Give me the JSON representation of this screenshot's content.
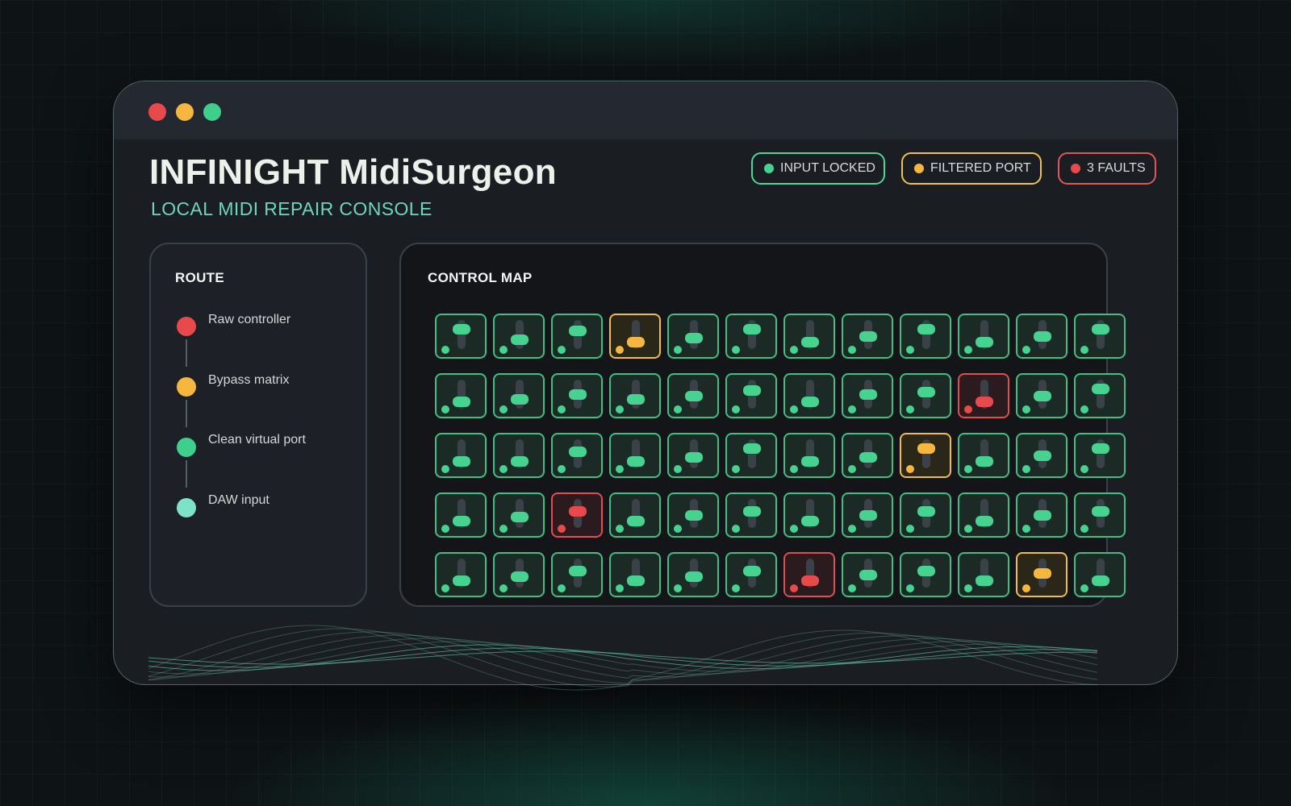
{
  "window": {
    "controls": [
      "close",
      "minimize",
      "maximize"
    ]
  },
  "header": {
    "title": "INFINIGHT MidiSurgeon",
    "subtitle": "LOCAL MIDI REPAIR CONSOLE"
  },
  "status": {
    "input": "INPUT LOCKED",
    "port": "FILTERED PORT",
    "faults": "3 FAULTS"
  },
  "route": {
    "title": "ROUTE",
    "steps": [
      {
        "label": "Raw controller",
        "color": "#e84a4c"
      },
      {
        "label": "Bypass matrix",
        "color": "#f6b73f"
      },
      {
        "label": "Clean virtual port",
        "color": "#3fcf8c"
      },
      {
        "label": "DAW input",
        "color": "#7ee2c6"
      }
    ]
  },
  "control_map": {
    "title": "CONTROL MAP",
    "columns": 12,
    "rows": [
      [
        {
          "s": "ok",
          "v": 0.8
        },
        {
          "s": "ok",
          "v": 0.2
        },
        {
          "s": "ok",
          "v": 0.7
        },
        {
          "s": "filtered",
          "v": 0.1
        },
        {
          "s": "ok",
          "v": 0.3
        },
        {
          "s": "ok",
          "v": 0.8
        },
        {
          "s": "ok",
          "v": 0.1
        },
        {
          "s": "ok",
          "v": 0.4
        },
        {
          "s": "ok",
          "v": 0.8
        },
        {
          "s": "ok",
          "v": 0.1
        },
        {
          "s": "ok",
          "v": 0.4
        },
        {
          "s": "ok",
          "v": 0.8
        }
      ],
      [
        {
          "s": "ok",
          "v": 0.1
        },
        {
          "s": "ok",
          "v": 0.2
        },
        {
          "s": "ok",
          "v": 0.5
        },
        {
          "s": "ok",
          "v": 0.2
        },
        {
          "s": "ok",
          "v": 0.4
        },
        {
          "s": "ok",
          "v": 0.7
        },
        {
          "s": "ok",
          "v": 0.1
        },
        {
          "s": "ok",
          "v": 0.5
        },
        {
          "s": "ok",
          "v": 0.6
        },
        {
          "s": "fault",
          "v": 0.1
        },
        {
          "s": "ok",
          "v": 0.4
        },
        {
          "s": "ok",
          "v": 0.8
        }
      ],
      [
        {
          "s": "ok",
          "v": 0.1
        },
        {
          "s": "ok",
          "v": 0.1
        },
        {
          "s": "ok",
          "v": 0.6
        },
        {
          "s": "ok",
          "v": 0.1
        },
        {
          "s": "ok",
          "v": 0.3
        },
        {
          "s": "ok",
          "v": 0.8
        },
        {
          "s": "ok",
          "v": 0.1
        },
        {
          "s": "ok",
          "v": 0.3
        },
        {
          "s": "filtered",
          "v": 0.8
        },
        {
          "s": "ok",
          "v": 0.1
        },
        {
          "s": "ok",
          "v": 0.4
        },
        {
          "s": "ok",
          "v": 0.8
        }
      ],
      [
        {
          "s": "ok",
          "v": 0.1
        },
        {
          "s": "ok",
          "v": 0.3
        },
        {
          "s": "fault",
          "v": 0.6
        },
        {
          "s": "ok",
          "v": 0.1
        },
        {
          "s": "ok",
          "v": 0.4
        },
        {
          "s": "ok",
          "v": 0.6
        },
        {
          "s": "ok",
          "v": 0.1
        },
        {
          "s": "ok",
          "v": 0.4
        },
        {
          "s": "ok",
          "v": 0.6
        },
        {
          "s": "ok",
          "v": 0.1
        },
        {
          "s": "ok",
          "v": 0.4
        },
        {
          "s": "ok",
          "v": 0.6
        }
      ],
      [
        {
          "s": "ok",
          "v": 0.1
        },
        {
          "s": "ok",
          "v": 0.3
        },
        {
          "s": "ok",
          "v": 0.6
        },
        {
          "s": "ok",
          "v": 0.1
        },
        {
          "s": "ok",
          "v": 0.3
        },
        {
          "s": "ok",
          "v": 0.6
        },
        {
          "s": "fault",
          "v": 0.1
        },
        {
          "s": "ok",
          "v": 0.4
        },
        {
          "s": "ok",
          "v": 0.6
        },
        {
          "s": "ok",
          "v": 0.1
        },
        {
          "s": "filtered",
          "v": 0.5
        },
        {
          "s": "ok",
          "v": 0.1
        }
      ]
    ]
  },
  "colors": {
    "ok": "#45d38f",
    "filtered": "#f6b73f",
    "fault": "#e84a4c",
    "accent": "#6dd6bd"
  }
}
